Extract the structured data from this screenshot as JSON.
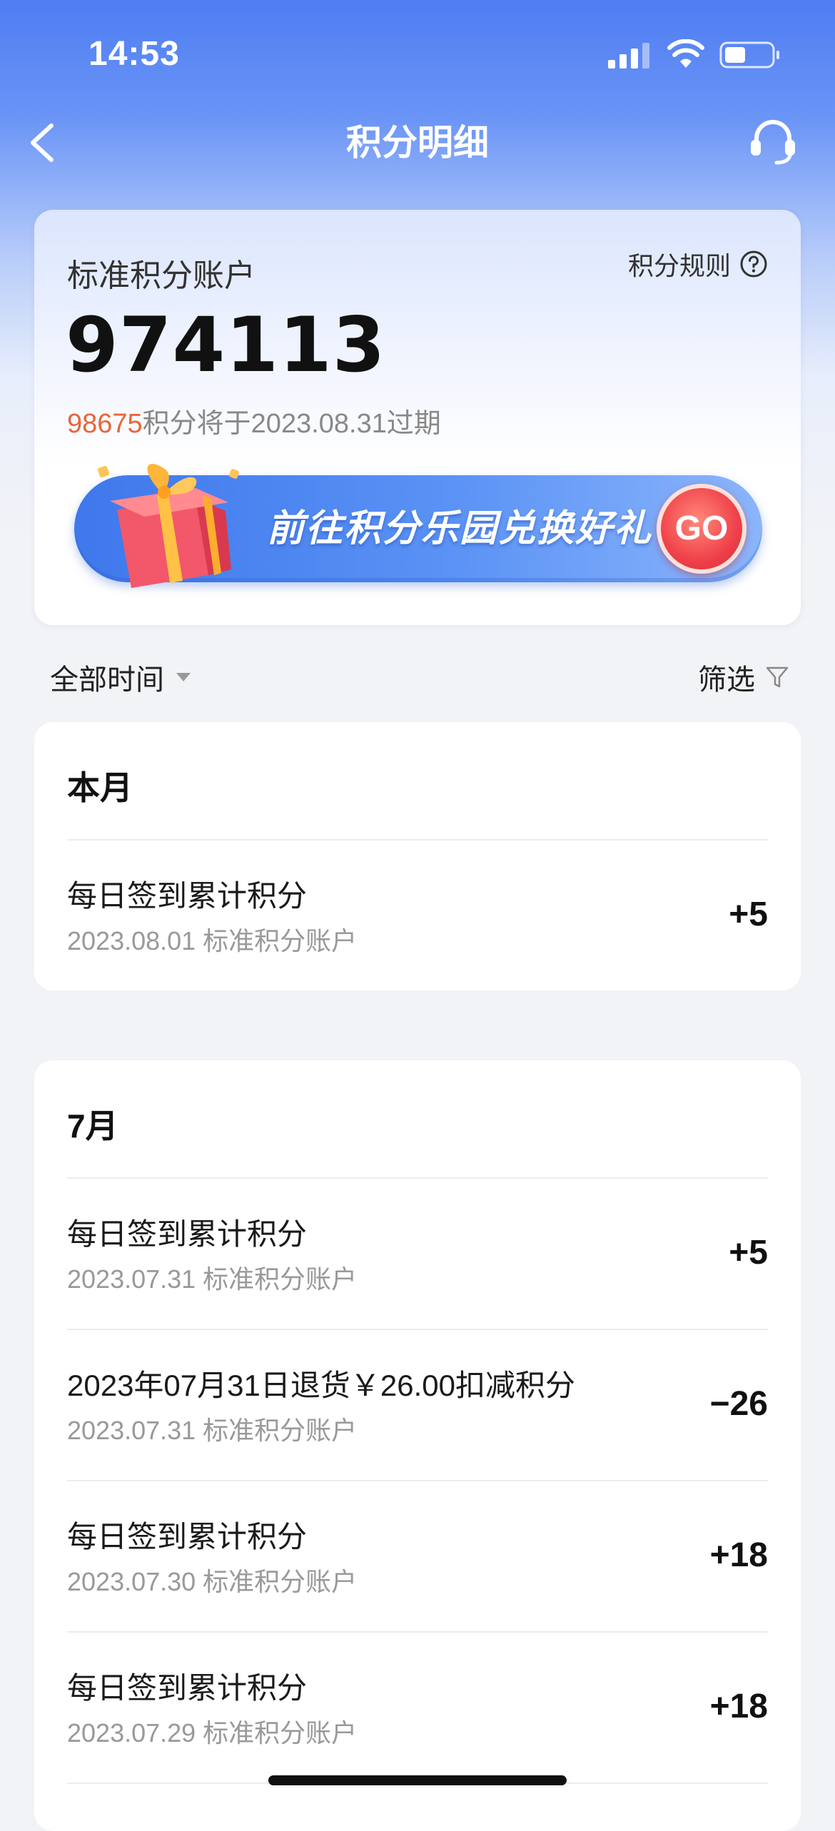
{
  "status_bar": {
    "time": "14:53"
  },
  "nav": {
    "title": "积分明细"
  },
  "account": {
    "title": "标准积分账户",
    "rules_label": "积分规则",
    "total_points": "974113",
    "expiring_amount": "98675",
    "expiring_text": "积分将于2023.08.31过期"
  },
  "banner": {
    "text": "前往积分乐园兑换好礼",
    "go_label": "GO"
  },
  "filters": {
    "time_label": "全部时间",
    "filter_label": "筛选"
  },
  "months": [
    {
      "title": "本月",
      "records": [
        {
          "title": "每日签到累计积分",
          "sub": "2023.08.01 标准积分账户",
          "amount": "+5"
        }
      ]
    },
    {
      "title": "7月",
      "records": [
        {
          "title": "每日签到累计积分",
          "sub": "2023.07.31 标准积分账户",
          "amount": "+5"
        },
        {
          "title": "2023年07月31日退货￥26.00扣减积分",
          "sub": "2023.07.31 标准积分账户",
          "amount": "−26"
        },
        {
          "title": "每日签到累计积分",
          "sub": "2023.07.30 标准积分账户",
          "amount": "+18"
        },
        {
          "title": "每日签到累计积分",
          "sub": "2023.07.29 标准积分账户",
          "amount": "+18"
        }
      ]
    }
  ],
  "colors": {
    "brand_blue": "#4f7df3",
    "expire_orange": "#e8653a",
    "go_red": "#f0414a"
  }
}
